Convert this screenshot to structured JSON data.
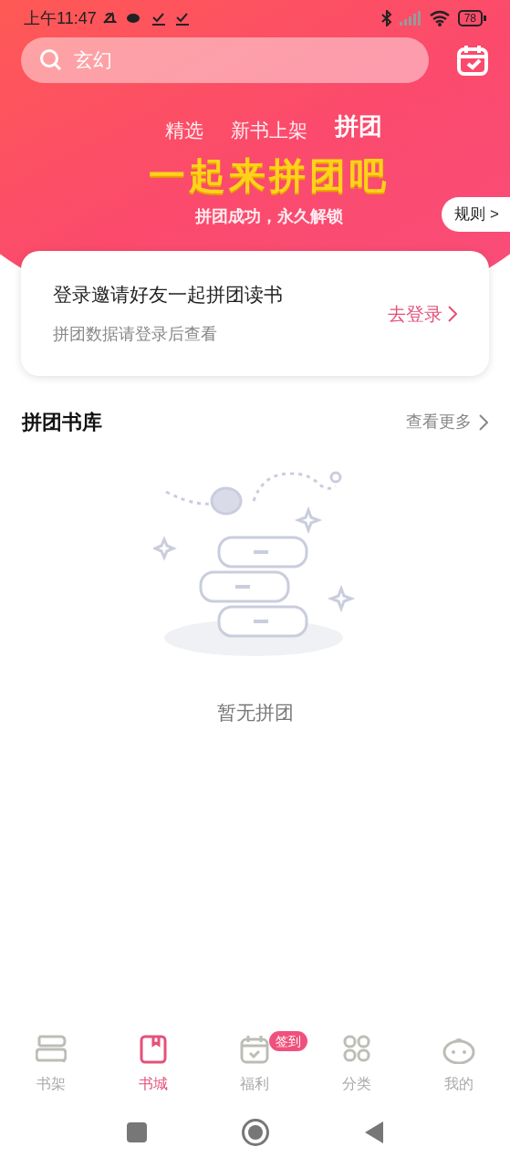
{
  "status_bar": {
    "time": "上午11:47",
    "battery": "78"
  },
  "search": {
    "value": "玄幻"
  },
  "tabs": [
    {
      "label": "精选",
      "selected": false
    },
    {
      "label": "新书上架",
      "selected": false
    },
    {
      "label": "拼团",
      "selected": true
    }
  ],
  "banner": {
    "title": "一起来拼团吧",
    "subtitle": "拼团成功，永久解锁",
    "rules_button": "规则 >"
  },
  "login_card": {
    "title": "登录邀请好友一起拼团读书",
    "subtitle": "拼团数据请登录后查看",
    "action": "去登录"
  },
  "section": {
    "title": "拼团书库",
    "more": "查看更多"
  },
  "empty_state": {
    "text": "暂无拼团"
  },
  "bottom_nav": [
    {
      "kind": "shelf",
      "label": "书架",
      "selected": false
    },
    {
      "kind": "store",
      "label": "书城",
      "selected": true
    },
    {
      "kind": "welfare",
      "label": "福利",
      "selected": false,
      "badge": "签到"
    },
    {
      "kind": "category",
      "label": "分类",
      "selected": false
    },
    {
      "kind": "mine",
      "label": "我的",
      "selected": false
    }
  ]
}
